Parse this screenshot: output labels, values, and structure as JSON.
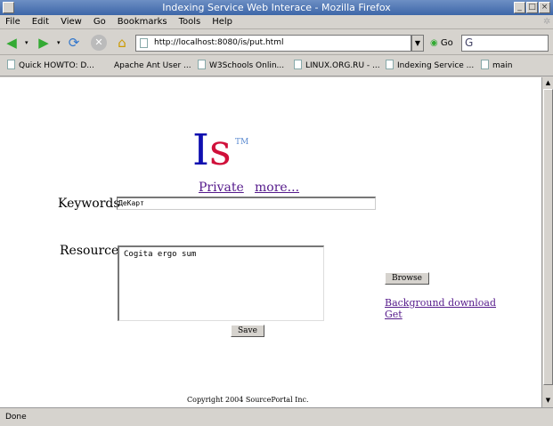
{
  "window": {
    "title": "Indexing Service Web Interace - Mozilla Firefox"
  },
  "menu": [
    "File",
    "Edit",
    "View",
    "Go",
    "Bookmarks",
    "Tools",
    "Help"
  ],
  "nav": {
    "url": "http://localhost:8080/is/put.html",
    "go_label": "Go",
    "search_value": "G"
  },
  "bookmarks": [
    "Quick HOWTO: D...",
    "Apache Ant User ...",
    "W3Schools Onlin...",
    "LINUX.ORG.RU - ...",
    "Indexing Service ...",
    "main"
  ],
  "page": {
    "logo_i": "I",
    "logo_s": "s",
    "logo_tm": "TM",
    "link_private": "Private",
    "link_more": "more...",
    "keywords_label": "Keywords",
    "keywords_value": "ДеКарт",
    "resource_label": "Resource",
    "resource_value": "Cogita ergo sum",
    "browse_label": "Browse",
    "link_background": "Background download",
    "link_get": "Get",
    "save_label": "Save",
    "copyright": "Copyright  2004  SourcePortal Inc."
  },
  "status": "Done"
}
